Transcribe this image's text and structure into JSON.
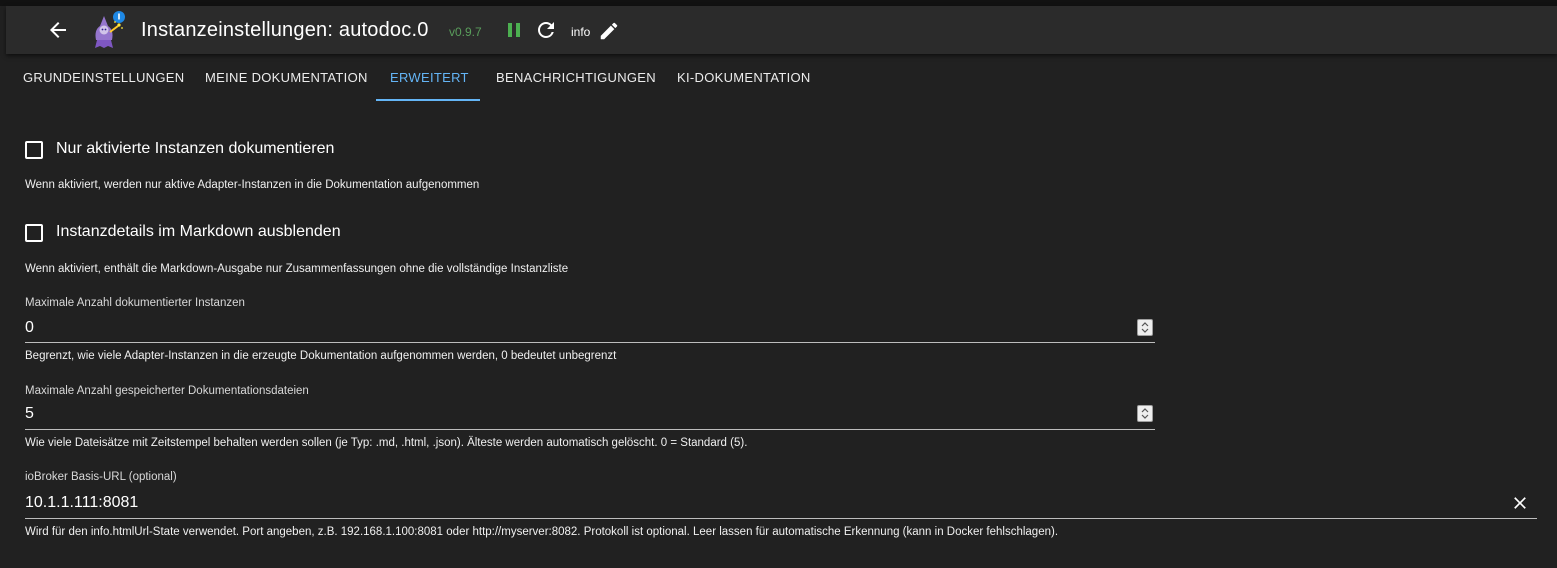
{
  "header": {
    "title": "Instanzeinstellungen: autodoc.0",
    "version": "v0.9.7",
    "log_level": "info",
    "icons": {
      "back": "arrow-left-icon",
      "logo": "autodoc-logo",
      "pause": "pause-icon",
      "reload": "reload-icon",
      "edit": "pencil-icon"
    },
    "colors": {
      "version": "#5a9e5c",
      "pause": "#4caf50"
    }
  },
  "tabs": [
    {
      "label": "GRUNDEINSTELLUNGEN",
      "active": false
    },
    {
      "label": "MEINE DOKUMENTATION",
      "active": false
    },
    {
      "label": "ERWEITERT",
      "active": true
    },
    {
      "label": "BENACHRICHTIGUNGEN",
      "active": false
    },
    {
      "label": "KI-DOKUMENTATION",
      "active": false
    }
  ],
  "accent_color": "#64b5f6",
  "settings": {
    "only_active": {
      "label": "Nur aktivierte Instanzen dokumentieren",
      "checked": false,
      "help": "Wenn aktiviert, werden nur aktive Adapter-Instanzen in die Dokumentation aufgenommen"
    },
    "hide_details": {
      "label": "Instanzdetails im Markdown ausblenden",
      "checked": false,
      "help": "Wenn aktiviert, enthält die Markdown-Ausgabe nur Zusammenfassungen ohne die vollständige Instanzliste"
    },
    "max_instances": {
      "label": "Maximale Anzahl dokumentierter Instanzen",
      "value": "0",
      "help": "Begrenzt, wie viele Adapter-Instanzen in die erzeugte Dokumentation aufgenommen werden, 0 bedeutet unbegrenzt"
    },
    "max_files": {
      "label": "Maximale Anzahl gespeicherter Dokumentationsdateien",
      "value": "5",
      "help": "Wie viele Dateisätze mit Zeitstempel behalten werden sollen (je Typ: .md, .html, .json). Älteste werden automatisch gelöscht. 0 = Standard (5)."
    },
    "base_url": {
      "label": "ioBroker Basis-URL (optional)",
      "value": "10.1.1.111:8081",
      "help": "Wird für den info.htmlUrl-State verwendet. Port angeben, z.B. 192.168.1.100:8081 oder http://myserver:8082. Protokoll ist optional. Leer lassen für automatische Erkennung (kann in Docker fehlschlagen)."
    }
  }
}
